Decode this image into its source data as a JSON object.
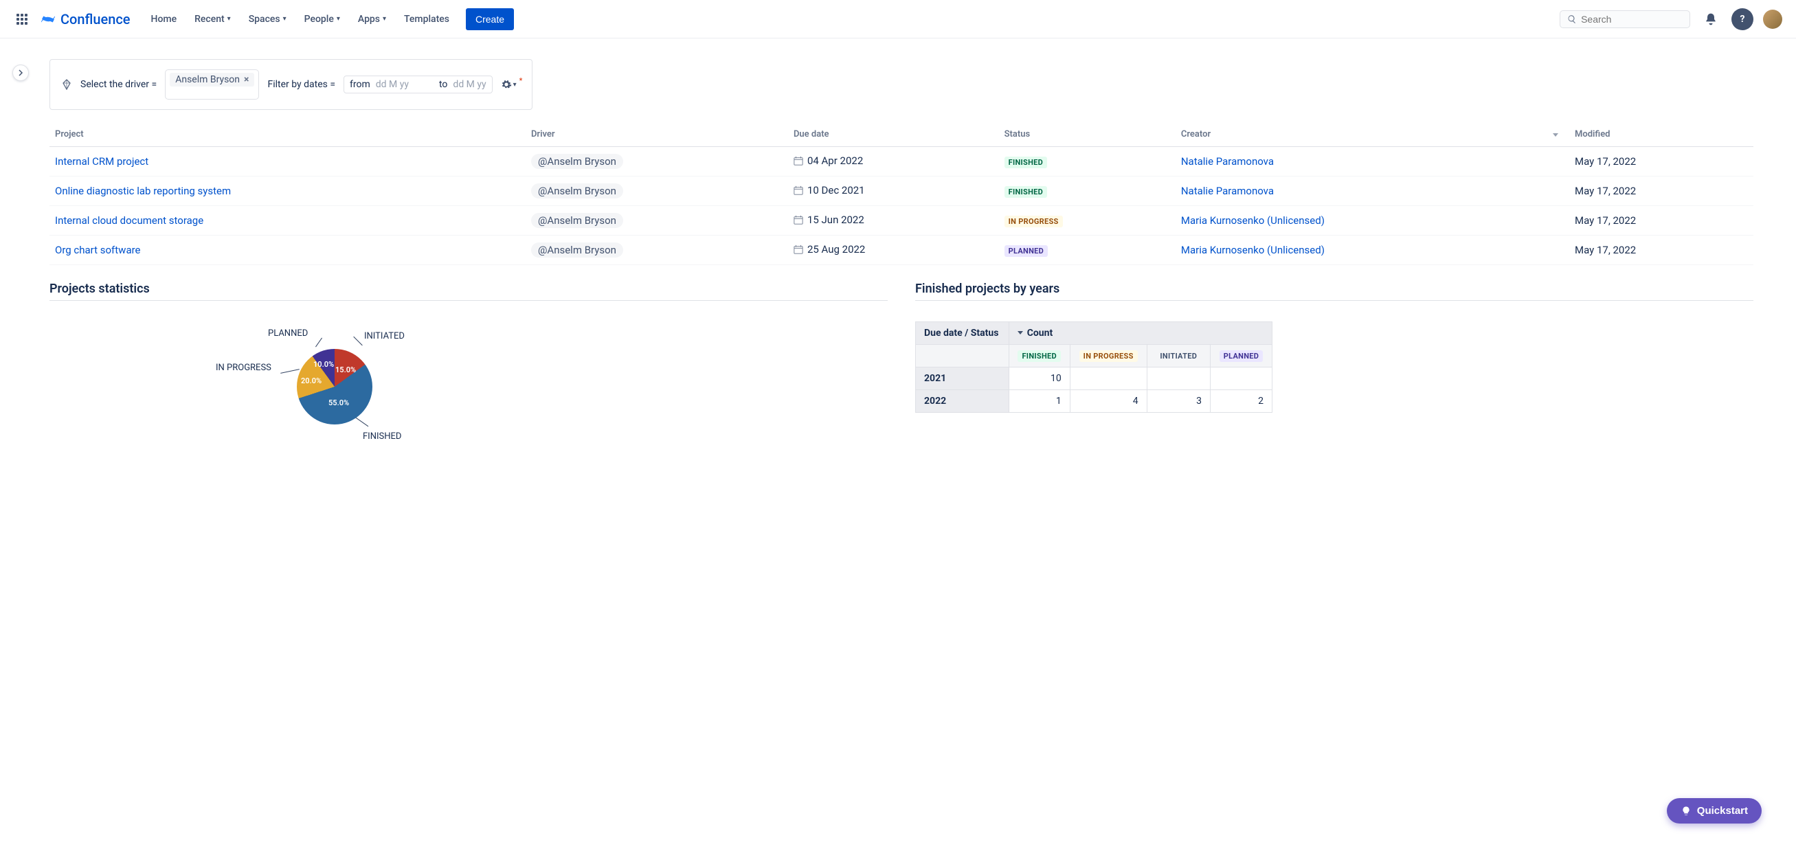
{
  "brand": "Confluence",
  "nav": {
    "home": "Home",
    "recent": "Recent",
    "spaces": "Spaces",
    "people": "People",
    "apps": "Apps",
    "templates": "Templates"
  },
  "create": "Create",
  "search_placeholder": "Search",
  "filter": {
    "select_driver_label": "Select the driver =",
    "driver_tag": "Anselm Bryson",
    "dates_label": "Filter by dates =",
    "from_kw": "from",
    "to_kw": "to",
    "date_placeholder": "dd M yy"
  },
  "columns": {
    "project": "Project",
    "driver": "Driver",
    "due": "Due date",
    "status": "Status",
    "creator": "Creator",
    "modified": "Modified"
  },
  "rows": [
    {
      "project": "Internal CRM project",
      "driver": "@Anselm Bryson",
      "due": "04 Apr 2022",
      "status": "FINISHED",
      "status_cls": "lz-finished",
      "creator": "Natalie Paramonova",
      "modified": "May 17, 2022"
    },
    {
      "project": "Online diagnostic lab reporting system",
      "driver": "@Anselm Bryson",
      "due": "10 Dec 2021",
      "status": "FINISHED",
      "status_cls": "lz-finished",
      "creator": "Natalie Paramonova",
      "modified": "May 17, 2022"
    },
    {
      "project": "Internal cloud document storage",
      "driver": "@Anselm Bryson",
      "due": "15 Jun 2022",
      "status": "IN PROGRESS",
      "status_cls": "lz-inprogress",
      "creator": "Maria Kurnosenko (Unlicensed)",
      "modified": "May 17, 2022"
    },
    {
      "project": "Org chart software",
      "driver": "@Anselm Bryson",
      "due": "25 Aug 2022",
      "status": "PLANNED",
      "status_cls": "lz-planned",
      "creator": "Maria Kurnosenko (Unlicensed)",
      "modified": "May 17, 2022"
    }
  ],
  "sections": {
    "stats": "Projects statistics",
    "by_year": "Finished projects by years"
  },
  "chart_data": {
    "type": "pie",
    "title": "Projects statistics",
    "series": [
      {
        "name": "INITIATED",
        "value": 15.0,
        "color": "#c0392b"
      },
      {
        "name": "FINISHED",
        "value": 55.0,
        "color": "#2c6aa0"
      },
      {
        "name": "IN PROGRESS",
        "value": 20.0,
        "color": "#e5a82e"
      },
      {
        "name": "PLANNED",
        "value": 10.0,
        "color": "#403294"
      }
    ]
  },
  "pivot": {
    "row_header": "Due date / Status",
    "count_header": "Count",
    "cols": [
      {
        "label": "FINISHED",
        "cls": "lz-finished"
      },
      {
        "label": "IN PROGRESS",
        "cls": "lz-inprogress"
      },
      {
        "label": "INITIATED",
        "cls": "lz-initiated"
      },
      {
        "label": "PLANNED",
        "cls": "lz-planned"
      }
    ],
    "rows": [
      {
        "year": "2021",
        "cells": [
          "10",
          "",
          "",
          ""
        ]
      },
      {
        "year": "2022",
        "cells": [
          "1",
          "4",
          "3",
          "2"
        ]
      }
    ]
  },
  "quickstart": "Quickstart"
}
